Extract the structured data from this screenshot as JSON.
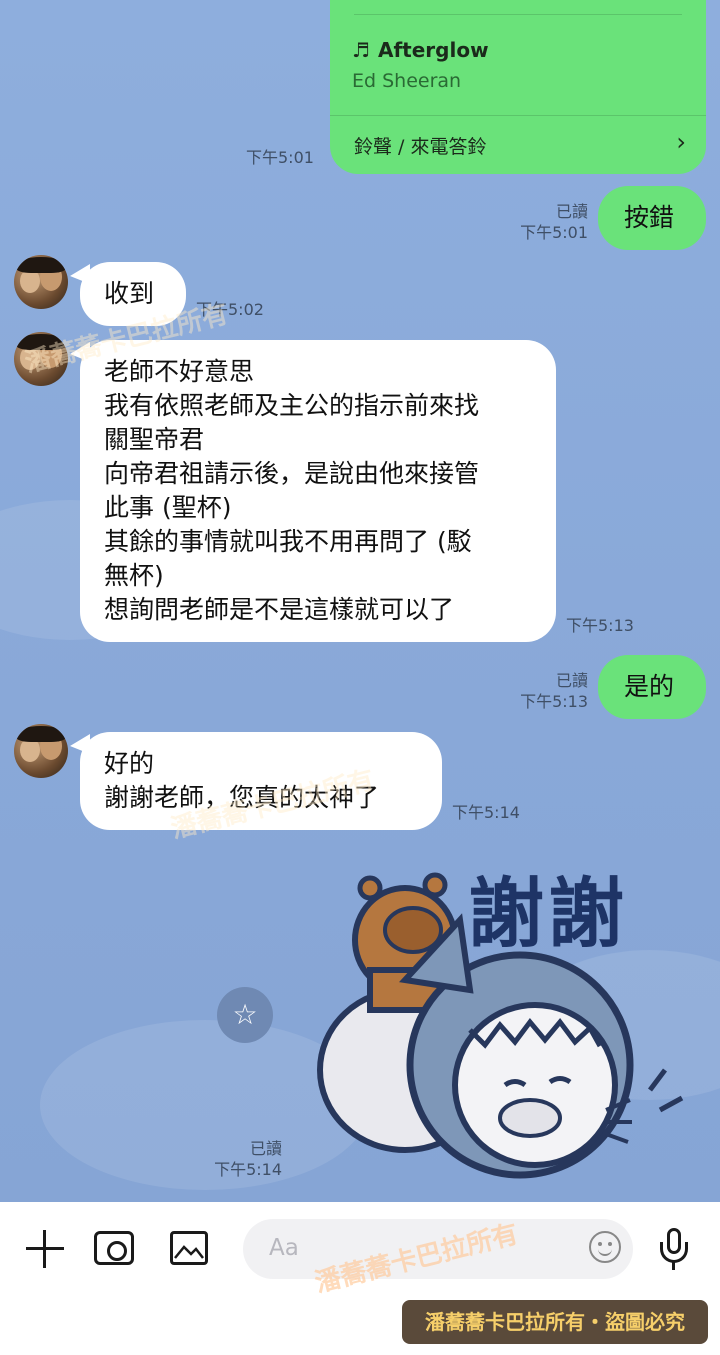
{
  "music_card": {
    "note_glyph": "♬",
    "title": "Afterglow",
    "artist": "Ed Sheeran",
    "ringtone_label": "鈴聲 / 來電答鈴",
    "chevron": "›",
    "time": "下午5:01"
  },
  "messages": [
    {
      "id": "m1",
      "side": "out",
      "text": "按錯",
      "read": "已讀",
      "time": "下午5:01"
    },
    {
      "id": "m2",
      "side": "in",
      "text": "收到",
      "time": "下午5:02"
    },
    {
      "id": "m3",
      "side": "in",
      "lines": [
        "老師不好意思",
        "我有依照老師及主公的指示前來找",
        "關聖帝君",
        "向帝君祖請示後，是說由他來接管",
        "此事 (聖杯)",
        "其餘的事情就叫我不用再問了 (駁",
        "無杯)",
        "想詢問老師是不是這樣就可以了"
      ],
      "time": "下午5:13"
    },
    {
      "id": "m4",
      "side": "out",
      "text": "是的",
      "read": "已讀",
      "time": "下午5:13"
    },
    {
      "id": "m5",
      "side": "in",
      "lines": [
        "好的",
        "謝謝老師，您真的太神了"
      ],
      "time": "下午5:14"
    },
    {
      "id": "m6",
      "side": "out",
      "sticker_text": "謝謝",
      "read": "已讀",
      "time": "下午5:14"
    }
  ],
  "input": {
    "placeholder": "Aa"
  },
  "icons": {
    "plus": "plus-icon",
    "camera": "camera-icon",
    "image": "image-icon",
    "emoji": "emoji-icon",
    "mic": "microphone-icon",
    "star": "star-icon"
  },
  "watermarks": {
    "overlay": "潘蕎蕎卡巴拉所有",
    "footer": "潘蕎蕎卡巴拉所有・盜圖必究"
  },
  "colors": {
    "bg": "#8eaedd",
    "bubble_out": "#6ae27a",
    "bubble_in": "#ffffff"
  }
}
